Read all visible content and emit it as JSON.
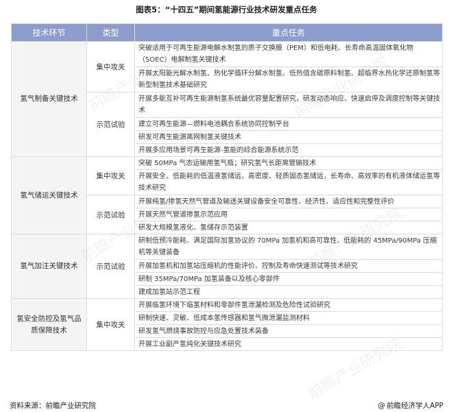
{
  "title": "图表5：“十四五”期间氢能源行业技术研发重点任务",
  "headers": [
    "技术环节",
    "类型",
    "重点任务"
  ],
  "groups": [
    {
      "name": "氢气制备关键技术",
      "types": [
        {
          "name": "集中攻关",
          "tasks": [
            "突破适用于可再生能源电解水制氢的质子交换膜（PEM）和低电耗、长寿命高温固体氧化物（SOEC）电解制氢关键技术",
            "开展太阳能光解水制氢、热化学循环分解水制氢、低热值含碳原料制氢、超临界水热化学还原制氢等新型制氢技术基础研究"
          ]
        },
        {
          "name": "示范试验",
          "tasks": [
            "开展多能互补可再生能源制氢系统最优容量配置研究，研发动态响应、快速启停及调度控制等关键技术",
            "建立可再生能源—燃料电池耦合系统协同控制平台",
            "研发可再生能源离网制氢关键技术",
            "开展多应用场景可再生能源-氢能的综合能源系统示范"
          ]
        }
      ]
    },
    {
      "name": "氢气储运关键技术",
      "types": [
        {
          "name": "集中攻关",
          "tasks": [
            "突破 50MPa 气态运输用氢气瓶；研究氢气长距离管输技术",
            "开展安全、低能耗的低温液氢储运，高密度、轻质固态氢储运，长寿命、高效率的有机液体储运氢等技术研究"
          ]
        },
        {
          "name": "示范试验",
          "tasks": [
            "开展纯氢/掺氢天然气管道及输送关键设备安全可靠性、经济性、适应性和完整性评价",
            "开展天然气管道掺氢示范应用",
            "研发大规模氢液化、氢储存示范装置"
          ]
        }
      ]
    },
    {
      "name": "氢气加注关键技术",
      "types": [
        {
          "name": "示范试验",
          "tasks": [
            "研制低预冷能耗、满足国际加氢协议的 70MPa 加氢机和高可靠性、低能耗的 45MPa/90MPa 压缩机等关键装备",
            "开展加氢机和加氢站压缩机的性能评价、控制及寿命快速测试等技术研究",
            "研制 35MPa/70MPa 加氢装备以及核心零部件",
            "建成加氢站示范工程"
          ]
        }
      ]
    },
    {
      "name": "氢安全防控及氢气品质保障技术",
      "types": [
        {
          "name": "集中攻关",
          "tasks": [
            "开展临氢环境下临氢材料和零部件氢泄漏检测及危险性试验研究",
            "研制快速、灵敏、低成本氢传感器和氢气微泄漏监测材料",
            "研发氢气燃烧事故防控与应急处置技术装备",
            "开展工业副产氢纯化关键技术研究"
          ]
        }
      ]
    }
  ],
  "footer": {
    "source": "资料来源：前瞻产业研究院",
    "brand_symbol": "@",
    "brand": "前瞻经济学人APP"
  },
  "watermark": "前瞻产业研究院"
}
